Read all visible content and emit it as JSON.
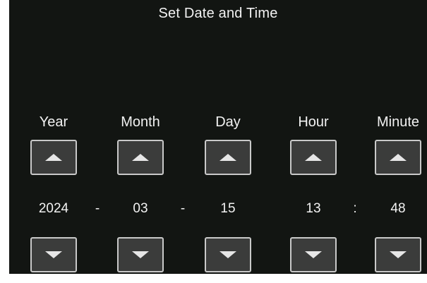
{
  "title": "Set Date and Time",
  "fields": [
    {
      "label": "Year",
      "value": "2024"
    },
    {
      "label": "Month",
      "value": "03"
    },
    {
      "label": "Day",
      "value": "15"
    },
    {
      "label": "Hour",
      "value": "13"
    },
    {
      "label": "Minute",
      "value": "48"
    }
  ],
  "separators": [
    "-",
    "-",
    ":"
  ],
  "icons": {
    "increment": "triangle-up-icon",
    "decrement": "triangle-down-icon"
  },
  "colors": {
    "background": "#121512",
    "button_fill": "#3b3c3b",
    "button_border": "#c9c9c9",
    "text": "#f2f2f2"
  }
}
